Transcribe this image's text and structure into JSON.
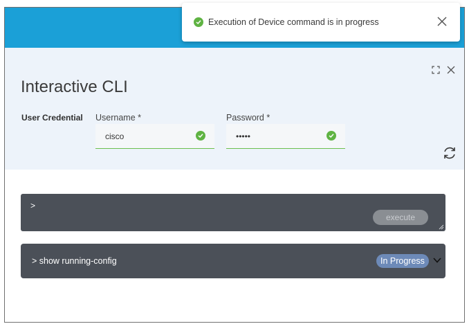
{
  "toast": {
    "message": "Execution of Device command is in progress",
    "status_icon": "check-circle-icon",
    "close_icon": "close-icon"
  },
  "panel": {
    "title": "Interactive CLI",
    "tools": [
      "expand-icon",
      "close-icon"
    ],
    "credential_label": "User Credential",
    "username": {
      "label": "Username *",
      "value": "cisco",
      "valid": true
    },
    "password": {
      "label": "Password *",
      "value": "•••••",
      "valid": true
    },
    "refresh_icon": "refresh-icon"
  },
  "console": {
    "prompt": ">",
    "execute_label": "execute"
  },
  "history": [
    {
      "command": "> show running-config",
      "status": "In Progress"
    }
  ],
  "colors": {
    "header": "#1ba0d7",
    "panel_bg": "#edf3fa",
    "success": "#5fb343",
    "console_bg": "#4b5058",
    "badge": "#6d8ab8"
  }
}
